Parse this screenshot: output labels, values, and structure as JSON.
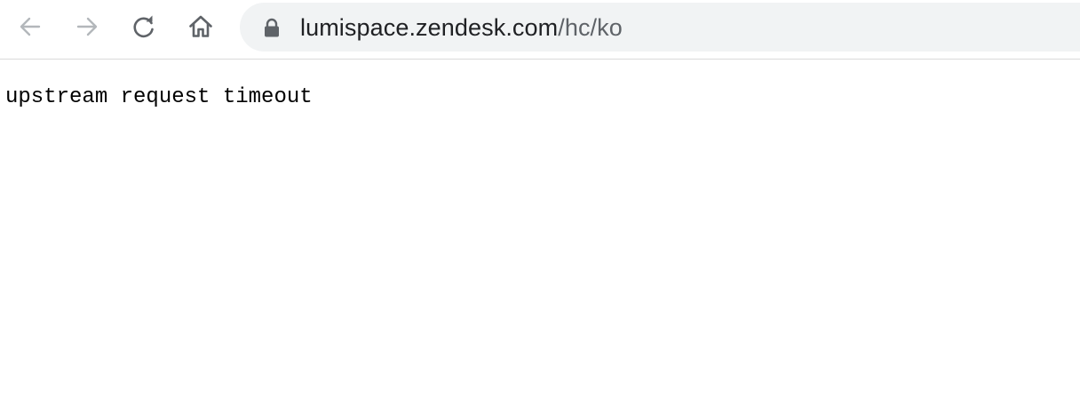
{
  "browser": {
    "toolbar": {
      "back_icon": "arrow-left-icon",
      "forward_icon": "arrow-right-icon",
      "reload_icon": "reload-icon",
      "home_icon": "home-icon"
    },
    "address_bar": {
      "security_icon": "lock-icon",
      "url_host": "lumispace.zendesk.com",
      "url_path": "/hc/ko"
    }
  },
  "page": {
    "body_text": "upstream request timeout"
  },
  "colors": {
    "toolbar_bg": "#ffffff",
    "omnibox_bg": "#f1f3f4",
    "icon_disabled": "#9aa0a6",
    "icon_active": "#5f6368",
    "url_host": "#202124",
    "url_path": "#5f6368",
    "page_text": "#000000"
  }
}
